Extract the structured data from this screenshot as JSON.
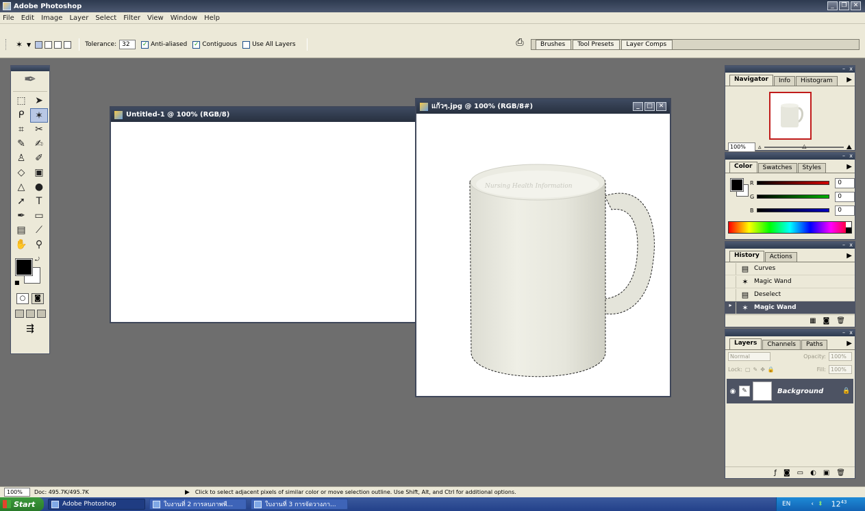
{
  "app": {
    "title": "Adobe Photoshop"
  },
  "menu": [
    "File",
    "Edit",
    "Image",
    "Layer",
    "Select",
    "Filter",
    "View",
    "Window",
    "Help"
  ],
  "options": {
    "tolerance_label": "Tolerance:",
    "tolerance_value": "32",
    "anti_aliased": "Anti-aliased",
    "contiguous": "Contiguous",
    "use_all_layers": "Use All Layers"
  },
  "palette_well": [
    "Brushes",
    "Tool Presets",
    "Layer Comps"
  ],
  "documents": {
    "untitled": {
      "title": "Untitled-1 @ 100% (RGB/8)"
    },
    "mug": {
      "title": "แก้วๆ.jpg @ 100% (RGB/8#)",
      "watermark": "Nursing Health Information"
    }
  },
  "navigator": {
    "tabs": [
      "Navigator",
      "Info",
      "Histogram"
    ],
    "zoom": "100%"
  },
  "color": {
    "tabs": [
      "Color",
      "Swatches",
      "Styles"
    ],
    "channels": [
      {
        "label": "R",
        "value": "0",
        "color": "#d00000"
      },
      {
        "label": "G",
        "value": "0",
        "color": "#00b000"
      },
      {
        "label": "B",
        "value": "0",
        "color": "#0000c0"
      }
    ]
  },
  "history": {
    "tabs": [
      "History",
      "Actions"
    ],
    "items": [
      "Curves",
      "Magic Wand",
      "Deselect",
      "Magic Wand"
    ]
  },
  "layers": {
    "tabs": [
      "Layers",
      "Channels",
      "Paths"
    ],
    "blend_mode": "Normal",
    "opacity_label": "Opacity:",
    "opacity_value": "100%",
    "lock_label": "Lock:",
    "fill_label": "Fill:",
    "fill_value": "100%",
    "layer_name": "Background"
  },
  "status": {
    "zoom": "100%",
    "doc": "Doc: 495.7K/495.7K",
    "hint": "Click to select adjacent pixels of similar color or move selection outline.  Use Shift, Alt, and Ctrl for additional options."
  },
  "taskbar": {
    "start": "Start",
    "tasks": [
      "Adobe Photoshop",
      "ใบงานที่ 2 การลบภาพพื...",
      "ใบงานที่ 3 การจัดวางภา..."
    ],
    "lang": "EN",
    "clock": "12",
    "clock_minutes": "43"
  }
}
